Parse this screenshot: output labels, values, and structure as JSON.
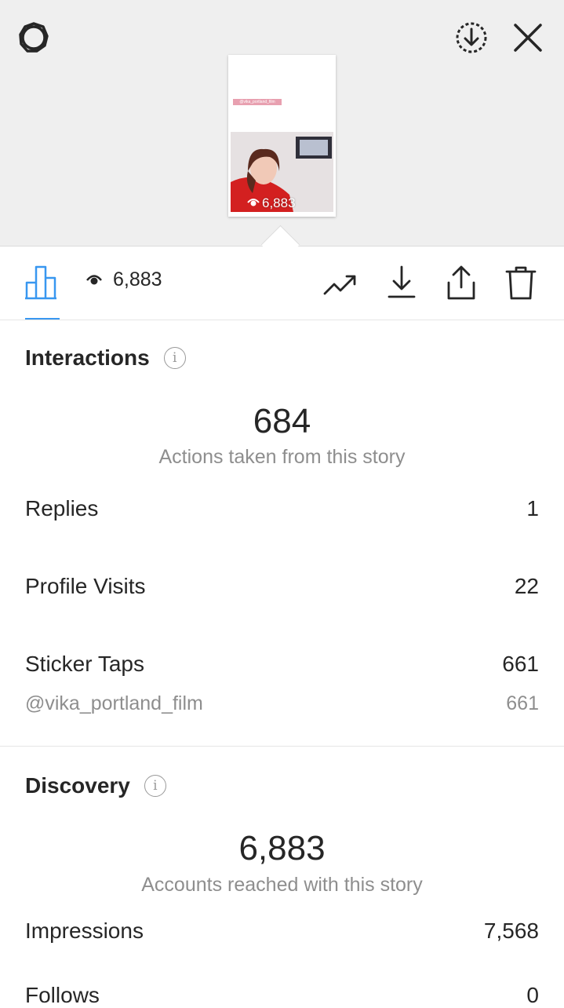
{
  "thumbnail": {
    "sticker_text": "@vika_portland_film",
    "view_count": "6,883"
  },
  "toolbar": {
    "view_count": "6,883"
  },
  "interactions": {
    "title": "Interactions",
    "total": "684",
    "total_caption": "Actions taken from this story",
    "rows": [
      {
        "label": "Replies",
        "value": "1"
      },
      {
        "label": "Profile Visits",
        "value": "22"
      },
      {
        "label": "Sticker Taps",
        "value": "661"
      }
    ],
    "sticker_breakdown": {
      "label": "@vika_portland_film",
      "value": "661"
    }
  },
  "discovery": {
    "title": "Discovery",
    "total": "6,883",
    "total_caption": "Accounts reached with this story",
    "rows": [
      {
        "label": "Impressions",
        "value": "7,568"
      },
      {
        "label": "Follows",
        "value": "0"
      }
    ]
  },
  "icons": [
    "settings-icon",
    "save-story-icon",
    "close-icon",
    "insights-bar-chart-icon",
    "eye-icon",
    "promote-trend-icon",
    "download-icon",
    "share-icon",
    "delete-trash-icon"
  ],
  "colors": {
    "accent": "#3897f0",
    "muted": "#8e8e8e",
    "text": "#262626"
  }
}
